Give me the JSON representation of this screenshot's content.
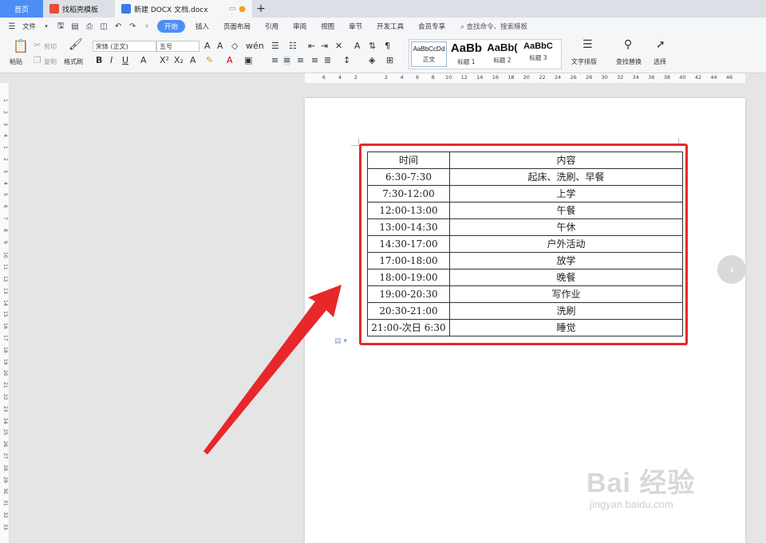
{
  "tabs": {
    "home": "首页",
    "template": "找稻壳模板",
    "document": "新建 DOCX 文档.docx",
    "new_tab": "+"
  },
  "menu": {
    "file": "文件",
    "items": [
      "开始",
      "插入",
      "页面布局",
      "引用",
      "审阅",
      "视图",
      "章节",
      "开发工具",
      "会员专享"
    ],
    "search": "查找命令、搜索模板"
  },
  "ribbon": {
    "paste": "粘贴",
    "cut": "剪切",
    "copy": "复制",
    "format_painter": "格式刷",
    "font_name": "宋体 (正文)",
    "font_size": "五号",
    "bold": "B",
    "italic": "I",
    "underline": "U",
    "styles": [
      {
        "preview": "AaBbCcDd",
        "label": "正文"
      },
      {
        "preview": "AaBb",
        "label": "标题 1"
      },
      {
        "preview": "AaBb(",
        "label": "标题 2"
      },
      {
        "preview": "AaBbC",
        "label": "标题 3"
      }
    ],
    "text_layout": "文字排版",
    "find_replace": "查找替换",
    "select": "选择"
  },
  "ruler": {
    "h_marks": [
      "6",
      "4",
      "2",
      "2",
      "4",
      "6",
      "8",
      "10",
      "12",
      "14",
      "16",
      "18",
      "20",
      "22",
      "24",
      "26",
      "28",
      "30",
      "32",
      "34",
      "36",
      "38",
      "40",
      "42",
      "44",
      "46"
    ],
    "v_marks": [
      "1",
      "2",
      "3",
      "4",
      "1",
      "2",
      "3",
      "4",
      "5",
      "6",
      "7",
      "8",
      "9",
      "10",
      "11",
      "12",
      "13",
      "14",
      "15",
      "16",
      "17",
      "18",
      "19",
      "20",
      "21",
      "22",
      "23",
      "24",
      "25",
      "26",
      "27",
      "28",
      "29",
      "30",
      "31",
      "32",
      "33"
    ]
  },
  "schedule": {
    "header": {
      "time": "时间",
      "content": "内容"
    },
    "rows": [
      {
        "time": "6:30-7:30",
        "content": "起床、洗刷、早餐"
      },
      {
        "time": "7:30-12:00",
        "content": "上学"
      },
      {
        "time": "12:00-13:00",
        "content": "午餐"
      },
      {
        "time": "13:00-14:30",
        "content": "午休"
      },
      {
        "time": "14:30-17:00",
        "content": "户外活动"
      },
      {
        "time": "17:00-18:00",
        "content": "放学"
      },
      {
        "time": "18:00-19:00",
        "content": "晚餐"
      },
      {
        "time": "19:00-20:30",
        "content": "写作业"
      },
      {
        "time": "20:30-21:00",
        "content": "洗刷"
      },
      {
        "time": "21:00-次日 6:30",
        "content": "睡觉"
      }
    ]
  },
  "watermark": {
    "main": "Bai 经验",
    "sub": "jingyan.baidu.com"
  },
  "colors": {
    "accent": "#4c8ef6",
    "highlight_box": "#e8272b",
    "arrow": "#e8272b"
  }
}
